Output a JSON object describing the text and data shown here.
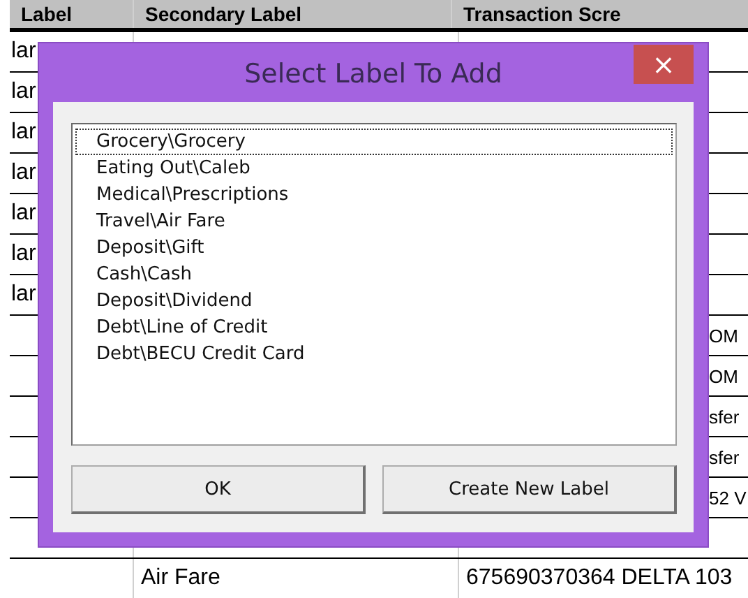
{
  "sheet": {
    "columns": [
      "Label",
      "Secondary Label",
      "Transaction Scre"
    ],
    "rows": [
      {
        "cells": [
          "lar",
          "",
          ""
        ]
      },
      {
        "cells": [
          "lar",
          "",
          ""
        ]
      },
      {
        "cells": [
          "lar",
          "",
          ""
        ]
      },
      {
        "cells": [
          "lar",
          "",
          ""
        ]
      },
      {
        "cells": [
          "lar",
          "",
          ""
        ]
      },
      {
        "cells": [
          "lar",
          "",
          ""
        ]
      },
      {
        "cells": [
          "lar",
          "",
          ""
        ]
      },
      {
        "cells": [
          "",
          "",
          "OM"
        ]
      },
      {
        "cells": [
          "",
          "",
          "OM"
        ]
      },
      {
        "cells": [
          "",
          "",
          "sfer"
        ]
      },
      {
        "cells": [
          "",
          "",
          "sfer"
        ]
      },
      {
        "cells": [
          "",
          "",
          "52 V"
        ]
      },
      {
        "cells": [
          "",
          "",
          ""
        ]
      },
      {
        "cells": [
          "",
          "Air Fare",
          "675690370364 DELTA 103"
        ]
      }
    ]
  },
  "dialog": {
    "title": "Select Label To Add",
    "close": "×",
    "items": [
      {
        "label": "Grocery\\Grocery",
        "selected": true
      },
      {
        "label": "Eating Out\\Caleb",
        "selected": false
      },
      {
        "label": "Medical\\Prescriptions",
        "selected": false
      },
      {
        "label": "Travel\\Air Fare",
        "selected": false
      },
      {
        "label": "Deposit\\Gift",
        "selected": false
      },
      {
        "label": "Cash\\Cash",
        "selected": false
      },
      {
        "label": "Deposit\\Dividend",
        "selected": false
      },
      {
        "label": "Debt\\Line of Credit",
        "selected": false
      },
      {
        "label": "Debt\\BECU Credit Card",
        "selected": false
      }
    ],
    "buttons": [
      "OK",
      "Create New Label"
    ]
  }
}
